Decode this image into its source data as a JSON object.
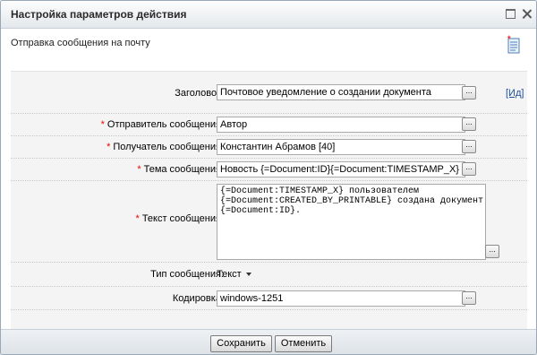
{
  "dialog": {
    "title": "Настройка параметров действия",
    "subtitle": "Отправка сообщения на почту"
  },
  "fields": {
    "header": {
      "label": "Заголовок:",
      "value": "Почтовое уведомление о создании документа",
      "link": "[Ид]"
    },
    "sender": {
      "label": "Отправитель сообщения:",
      "value": "Автор"
    },
    "recipient": {
      "label": "Получатель сообщения:",
      "value": "Константин Абрамов [40]"
    },
    "subject": {
      "label": "Тема сообщения:",
      "value": "Новость {=Document:ID}{=Document:TIMESTAMP_X}"
    },
    "body": {
      "label": "Текст сообщения:",
      "value": "{=Document:TIMESTAMP_X} пользователем\n{=Document:CREATED_BY_PRINTABLE} создана документ\n{=Document:ID}."
    },
    "type": {
      "label": "Тип сообщения:",
      "value": "Текст"
    },
    "encoding": {
      "label": "Кодировка:",
      "value": "windows-1251"
    }
  },
  "required_mark": "*",
  "browse_label": "...",
  "buttons": {
    "save": "Сохранить",
    "cancel": "Отменить"
  },
  "colors": {
    "required": "#ee0000",
    "link": "#1f4fa0"
  }
}
